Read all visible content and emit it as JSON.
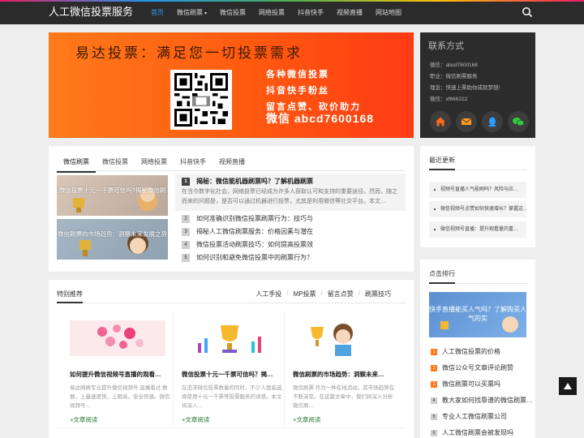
{
  "site": {
    "title": "人工微信投票服务"
  },
  "nav": [
    {
      "label": "首页",
      "active": true
    },
    {
      "label": "微信刷票",
      "caret": "▾"
    },
    {
      "label": "微信投票"
    },
    {
      "label": "网络投票"
    },
    {
      "label": "抖音快手"
    },
    {
      "label": "视频直播"
    },
    {
      "label": "网站地图"
    }
  ],
  "banner": {
    "title": "易达投票：满足您一切投票需求",
    "lines": [
      "各种微信投票",
      "抖音快手粉丝",
      "留言点赞、砍价助力"
    ],
    "contact": "微信  abcd7600168"
  },
  "contact": {
    "title": "联系方式",
    "lines": [
      "微信：abcd7600168",
      "职业：微信刷票服务",
      "理念：快速上票助你成就梦想!",
      "微信：xf666222"
    ],
    "icons": [
      "home-icon",
      "mail-icon",
      "qq-icon",
      "wechat-icon"
    ]
  },
  "news": {
    "tabs": [
      "微信刷票",
      "微信投票",
      "网络投票",
      "抖音快手",
      "视频直播"
    ],
    "thumbs": [
      "微信投票十元一千票可信吗?揭秘微信刷",
      "微信刷票的市场趋势：洞察未来发展之势"
    ],
    "feature": {
      "num": "1",
      "title": "揭秘：微信能机器刷票吗？了解机器刷票",
      "text": "在当今数字化社会，网络投票已经成为许多人获取认可和支持的重要途径。然而，随之而来的问题是，是否可以通过机器进行投票，尤其是利用微信等社交平台。本文…"
    },
    "items": [
      {
        "num": "2",
        "title": "如何准确识别微信投票刷票行为：技巧与"
      },
      {
        "num": "3",
        "title": "揭秘人工微信刷票服务：价格因素与潜在"
      },
      {
        "num": "4",
        "title": "微信投票活动刷票技巧：如何提高投票效"
      },
      {
        "num": "5",
        "title": "如何识别和避免微信投票中的刷票行为？"
      }
    ]
  },
  "recommend": {
    "title": "特别推荐",
    "links": [
      "人工手投",
      "MP投票",
      "留言点赞",
      "刷票技巧"
    ],
    "cards": [
      {
        "title": "如何提升微信视频号直播的观看…",
        "text": "易达网络专业提升微信视频号 直播看过 数据，上量速度快，上限高，安全快速。微信视频号…",
        "more": "+文章阅读"
      },
      {
        "title": "微信投票十元一千票可信吗？揭…",
        "text": "在追求微信投票数量的同时，不少人面临选择使用十元一千票等投票服务的诱惑。本文将深入…",
        "more": "+文章阅读"
      },
      {
        "title": "微信刷票的市场趋势：洞察未来…",
        "text": "微信刷票 作为一种在线活动，其市场趋势在不断演变。在这篇文章中，我们将深入分析微信刷…",
        "more": "+文章阅读"
      }
    ]
  },
  "latest": {
    "title": "最近更新",
    "items": [
      "视频号直播人气能刷吗？风险与应…",
      "微信视频号点赞如何快速增长？掌握这…",
      "微信视频号直播：提升观看量的重…"
    ]
  },
  "hot": {
    "title": "点击排行",
    "banner": "快手直播能买人气吗？了解购买人气的实",
    "items": [
      {
        "num": "1",
        "title": "人工微信投票的价格"
      },
      {
        "num": "2",
        "title": "微信公众号文章评论刷赞"
      },
      {
        "num": "3",
        "title": "微信刷票可以买票吗"
      },
      {
        "num": "4",
        "title": "教大家如何找靠谱的微信刷票…"
      },
      {
        "num": "5",
        "title": "专业人工微信刷票公司"
      },
      {
        "num": "6",
        "title": "人工微信刷票会被发现吗"
      }
    ]
  },
  "colors": {
    "accent": "#2e9bff",
    "banner": "#ff5a10",
    "navbar": "#2b2b2b",
    "read_more": "#2e7d32"
  }
}
